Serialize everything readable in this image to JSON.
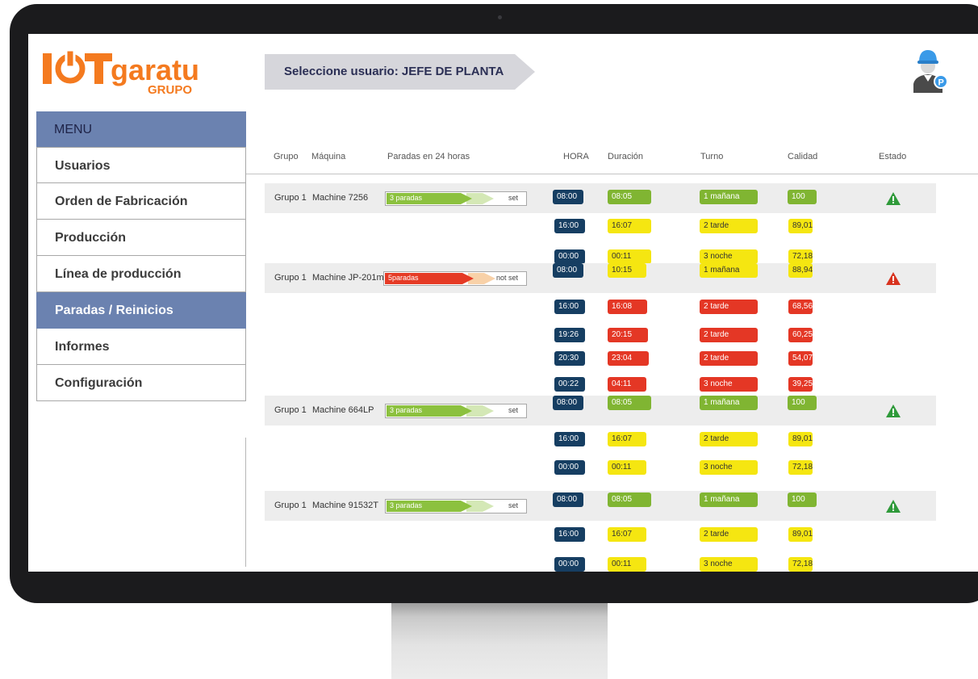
{
  "brand": {
    "logo_word": "garatu",
    "logo_sub": "GRUPO"
  },
  "header": {
    "user_selector": "Seleccione usuario: JEFE DE PLANTA"
  },
  "sidebar": {
    "title": "MENU",
    "items": [
      {
        "label": "Usuarios",
        "active": false
      },
      {
        "label": "Orden de Fabricación",
        "active": false
      },
      {
        "label": "Producción",
        "active": false
      },
      {
        "label": "Línea de producción",
        "active": false
      },
      {
        "label": "Paradas / Reinicios",
        "active": true
      },
      {
        "label": "Informes",
        "active": false
      },
      {
        "label": "Configuración",
        "active": false
      }
    ]
  },
  "table": {
    "columns": [
      "Grupo",
      "Máquina",
      "Paradas en 24 horas",
      "HORA",
      "Duración",
      "Turno",
      "Calidad",
      "Estado"
    ],
    "machines": [
      {
        "grupo": "Grupo 1",
        "maquina": "Machine 7256",
        "paradas_label": "3 paradas",
        "paradas_status": "set",
        "paradas_level": "ok",
        "estado": "warning-green",
        "rows": [
          {
            "hora": "08:00",
            "duracion": "08:05",
            "turno": "1 mañana",
            "calidad": "100",
            "color": "green"
          },
          {
            "hora": "16:00",
            "duracion": "16:07",
            "turno": "2 tarde",
            "calidad": "89,01",
            "color": "yellow"
          },
          {
            "hora": "00:00",
            "duracion": "00:11",
            "turno": "3 noche",
            "calidad": "72,18",
            "color": "yellow"
          }
        ]
      },
      {
        "grupo": "Grupo 1",
        "maquina": "Machine JP-201m",
        "paradas_label": "5paradas",
        "paradas_status": "not set",
        "paradas_level": "bad",
        "estado": "warning-red",
        "rows": [
          {
            "hora": "08:00",
            "duracion": "10:15",
            "turno": "1 mañana",
            "calidad": "88,94",
            "color": "yellow"
          },
          {
            "hora": "16:00",
            "duracion": "16:08",
            "turno": "2 tarde",
            "calidad": "68,56",
            "color": "red"
          },
          {
            "hora": "19:26",
            "duracion": "20:15",
            "turno": "2 tarde",
            "calidad": "60,25",
            "color": "red"
          },
          {
            "hora": "20:30",
            "duracion": "23:04",
            "turno": "2 tarde",
            "calidad": "54,07",
            "color": "red"
          },
          {
            "hora": "00:22",
            "duracion": "04:11",
            "turno": "3 noche",
            "calidad": "39,25",
            "color": "red"
          }
        ]
      },
      {
        "grupo": "Grupo 1",
        "maquina": "Machine 664LP",
        "paradas_label": "3 paradas",
        "paradas_status": "set",
        "paradas_level": "ok",
        "estado": "warning-green",
        "rows": [
          {
            "hora": "08:00",
            "duracion": "08:05",
            "turno": "1 mañana",
            "calidad": "100",
            "color": "green"
          },
          {
            "hora": "16:00",
            "duracion": "16:07",
            "turno": "2 tarde",
            "calidad": "89,01",
            "color": "yellow"
          },
          {
            "hora": "00:00",
            "duracion": "00:11",
            "turno": "3 noche",
            "calidad": "72,18",
            "color": "yellow"
          }
        ]
      },
      {
        "grupo": "Grupo 1",
        "maquina": "Machine 91532T",
        "paradas_label": "3 paradas",
        "paradas_status": "set",
        "paradas_level": "ok",
        "estado": "warning-green",
        "rows": [
          {
            "hora": "08:00",
            "duracion": "08:05",
            "turno": "1 mañana",
            "calidad": "100",
            "color": "green"
          },
          {
            "hora": "16:00",
            "duracion": "16:07",
            "turno": "2 tarde",
            "calidad": "89,01",
            "color": "yellow"
          },
          {
            "hora": "00:00",
            "duracion": "00:11",
            "turno": "3 noche",
            "calidad": "72,18",
            "color": "yellow"
          }
        ]
      }
    ]
  },
  "colors": {
    "accent": "#6b82b0",
    "hora": "#163e62",
    "green": "#80b532",
    "yellow": "#f5e611",
    "red": "#e43725",
    "brand_orange": "#f47a1f"
  }
}
